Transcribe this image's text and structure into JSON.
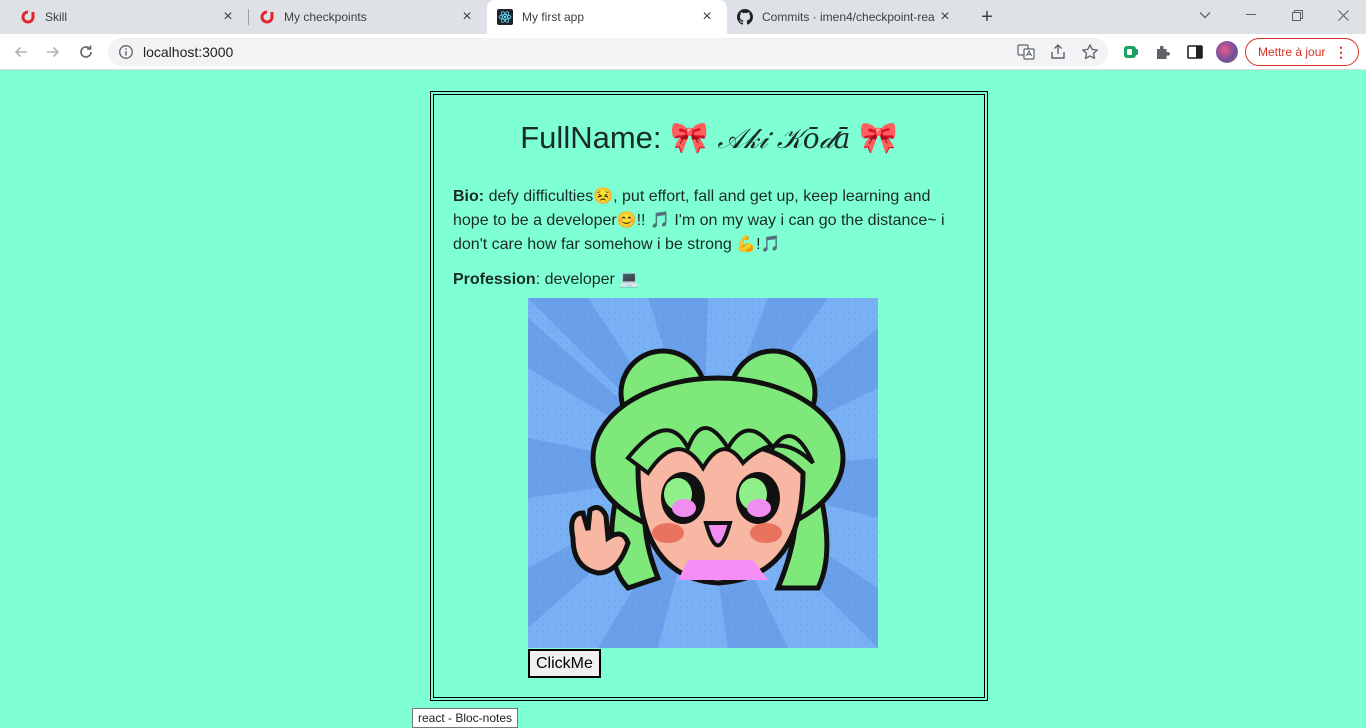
{
  "browser": {
    "tabs": [
      {
        "title": "Skill",
        "icon": "skill-logo-icon",
        "active": false
      },
      {
        "title": "My checkpoints",
        "icon": "skill-logo-icon",
        "active": false
      },
      {
        "title": "My first app",
        "icon": "react-logo-icon",
        "active": true
      },
      {
        "title": "Commits · imen4/checkpoint-rea",
        "icon": "github-icon",
        "active": false
      }
    ],
    "close_glyph": "×",
    "new_tab_glyph": "+",
    "url": "localhost:3000",
    "update_button_label": "Mettre à jour",
    "accent_color": "#d93025"
  },
  "profile": {
    "fullname_label": "FullName:",
    "fullname_left_emoji": "🎀",
    "fullname_value": "𝒜𝓀𝒾 𝒦ō𝒹ā",
    "fullname_right_emoji": "🎀",
    "bio_label": "Bio:",
    "bio_text": "defy difficulties😣, put effort, fall and get up, keep learning and hope to be a developer😊!! 🎵 I'm on my way i can go the distance~ i don't care how far somehow i be strong 💪!🎵",
    "profession_label": "Profession",
    "profession_text": ": developer 💻",
    "button_label": "ClickMe",
    "background_color": "#7fffd4"
  },
  "taskbar_tooltip": "react - Bloc-notes"
}
